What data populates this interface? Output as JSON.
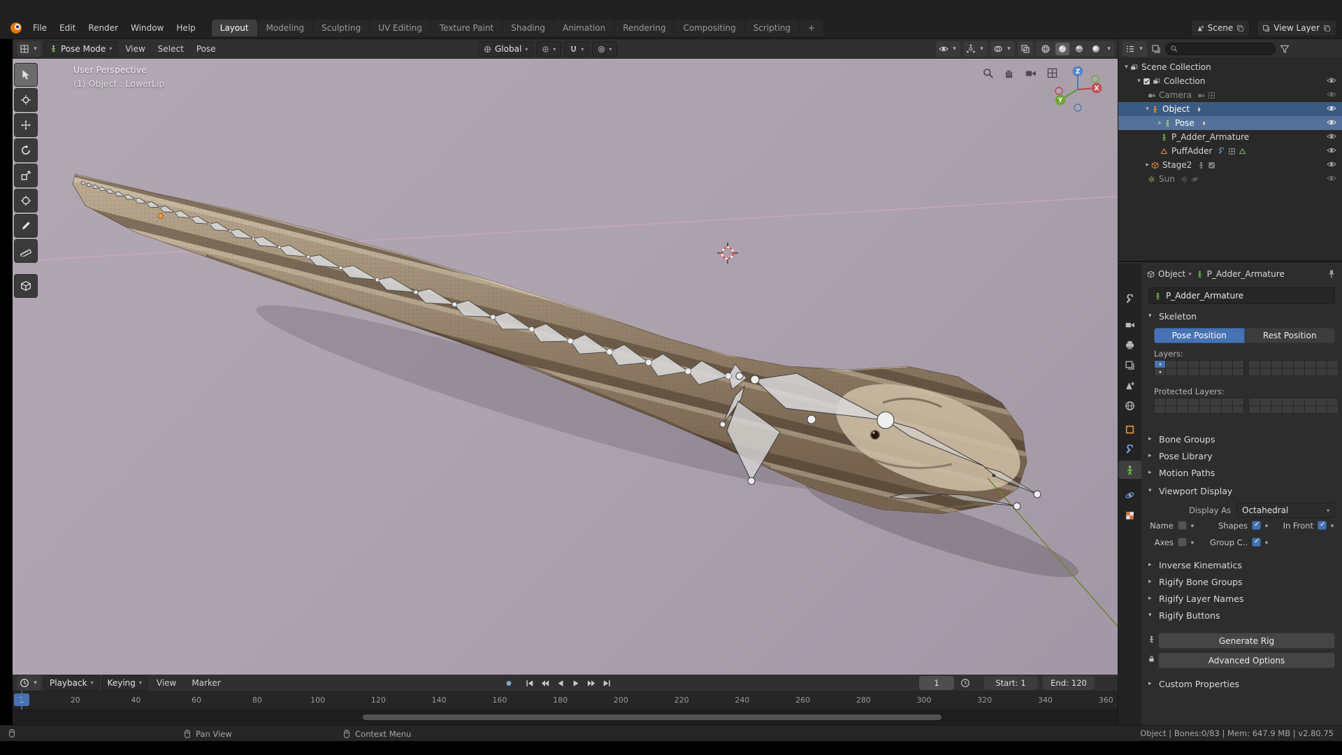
{
  "topbar": {
    "menus": [
      "File",
      "Edit",
      "Render",
      "Window",
      "Help"
    ],
    "tabs": [
      "Layout",
      "Modeling",
      "Sculpting",
      "UV Editing",
      "Texture Paint",
      "Shading",
      "Animation",
      "Rendering",
      "Compositing",
      "Scripting"
    ],
    "add_tab": "+",
    "scene_label": "Scene",
    "view_layer_label": "View Layer"
  },
  "viewport": {
    "mode": "Pose Mode",
    "menus": [
      "View",
      "Select",
      "Pose"
    ],
    "orientation": "Global",
    "overlay_line1": "User Perspective",
    "overlay_line2": "(1) Object : LowerLip",
    "gizmo": {
      "x": "X",
      "y": "Y",
      "z": "Z"
    }
  },
  "outliner": {
    "rows": [
      {
        "label": "Scene Collection"
      },
      {
        "label": "Collection"
      },
      {
        "label": "Camera"
      },
      {
        "label": "Object"
      },
      {
        "label": "Pose"
      },
      {
        "label": "P_Adder_Armature"
      },
      {
        "label": "PuffAdder"
      },
      {
        "label": "Stage2"
      },
      {
        "label": "Sun"
      }
    ]
  },
  "properties": {
    "breadcrumb_object": "Object",
    "breadcrumb_data": "P_Adder_Armature",
    "name_value": "P_Adder_Armature",
    "skeleton_title": "Skeleton",
    "pose_position": "Pose Position",
    "rest_position": "Rest Position",
    "layers_label": "Layers:",
    "protected_layers_label": "Protected Layers:",
    "layers": {
      "cols": 8,
      "rows": 2,
      "active": 0,
      "dots": [
        0,
        8
      ]
    },
    "protected_layers": {
      "cols": 8,
      "rows": 2,
      "active": -1,
      "dots": []
    },
    "bone_groups": "Bone Groups",
    "pose_library": "Pose Library",
    "motion_paths": "Motion Paths",
    "viewport_display_title": "Viewport Display",
    "display_as_label": "Display As",
    "display_as_value": "Octahedral",
    "checks": [
      {
        "label": "Name",
        "checked": false
      },
      {
        "label": "Shapes",
        "checked": true
      },
      {
        "label": "In Front",
        "checked": true
      },
      {
        "label": "Axes",
        "checked": false
      },
      {
        "label": "Group C..",
        "checked": true
      }
    ],
    "inverse_kinematics": "Inverse Kinematics",
    "rigify_bone_groups": "Rigify Bone Groups",
    "rigify_layer_names": "Rigify Layer Names",
    "rigify_buttons": "Rigify Buttons",
    "generate_rig": "Generate Rig",
    "advanced_options": "Advanced Options",
    "custom_properties": "Custom Properties"
  },
  "timeline": {
    "menus": [
      "Playback",
      "Keying",
      "View",
      "Marker"
    ],
    "current_frame": "1",
    "start_label": "Start:",
    "start_value": "1",
    "end_label": "End:",
    "end_value": "120",
    "ruler": [
      20,
      40,
      60,
      80,
      100,
      120,
      140,
      160,
      180,
      200,
      220,
      240,
      260,
      280,
      300,
      320,
      340,
      360
    ]
  },
  "statusbar": {
    "items": [
      "Pan View",
      "Context Menu"
    ],
    "right": "Object | Bones:0/83 | Mem: 647.9 MB | v2.80.75"
  },
  "colors": {
    "accent": "#4772b3",
    "viewport_bg": "#aca2ae",
    "selected_row": "#3a5a82",
    "active_row": "#54719a"
  }
}
